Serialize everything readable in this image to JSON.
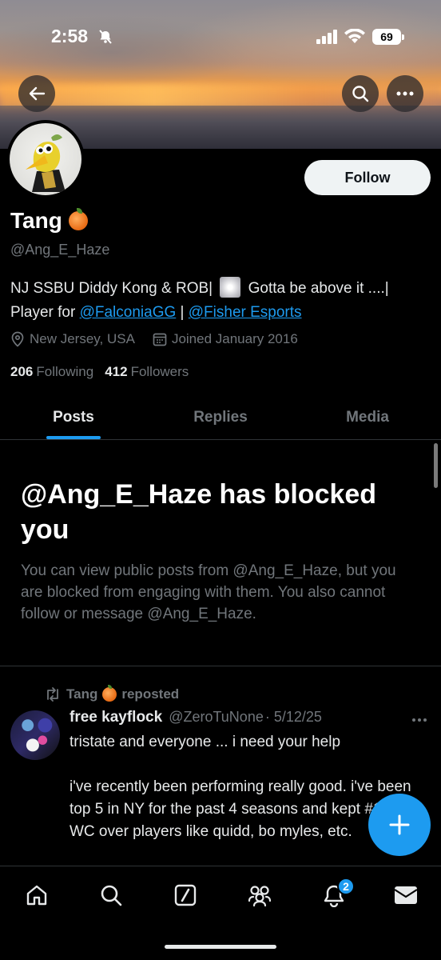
{
  "status_bar": {
    "time": "2:58",
    "battery": "69"
  },
  "profile": {
    "follow_label": "Follow",
    "name": "Tang",
    "handle": "@Ang_E_Haze",
    "bio_prefix": "NJ SSBU Diddy Kong & ROB|",
    "bio_middle": "Gotta be above it ....|",
    "bio_player_for": "Player for",
    "bio_link1": "@FalconiaGG",
    "bio_separator": "|",
    "bio_link2": "@Fisher Esports",
    "location": "New Jersey, USA",
    "joined": "Joined January 2016",
    "following_count": "206",
    "following_label": "Following",
    "followers_count": "412",
    "followers_label": "Followers"
  },
  "tabs": [
    {
      "label": "Posts",
      "active": true
    },
    {
      "label": "Replies",
      "active": false
    },
    {
      "label": "Media",
      "active": false
    }
  ],
  "blocked": {
    "title": "@Ang_E_Haze has blocked you",
    "message": "You can view public posts from @Ang_E_Haze, but you are blocked from engaging with them. You also cannot follow or message @Ang_E_Haze."
  },
  "post": {
    "repost_user": "Tang",
    "repost_label": "reposted",
    "author_name": "free kayflock",
    "author_handle": "@ZeroTuNone",
    "date": "· 5/12/25",
    "text": "tristate and everyone ... i need your help\n\ni've recently been performing really good. i've been top 5 in NY for the past 4 seasons and kept #1 in WC over players like quidd, bo myles, etc."
  },
  "nav": {
    "notifications_badge": "2"
  },
  "icons": [
    "back-arrow-icon",
    "search-icon",
    "more-icon",
    "location-icon",
    "calendar-icon",
    "repost-icon",
    "plus-icon",
    "home-icon",
    "search-icon",
    "grok-icon",
    "communities-icon",
    "bell-icon",
    "mail-icon"
  ],
  "colors": {
    "accent": "#1d9bf0",
    "muted": "#71767b",
    "text": "#e7e9ea",
    "background": "#000000"
  }
}
